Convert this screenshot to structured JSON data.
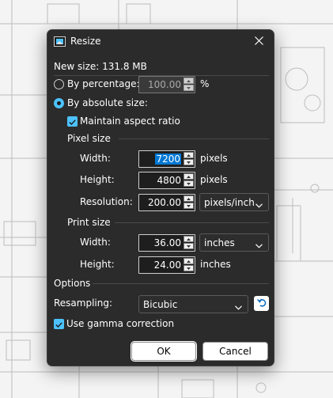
{
  "window": {
    "title": "Resize",
    "close_icon": "close-icon",
    "app_icon": "image-resize-icon"
  },
  "new_size": "New size: 131.8 MB",
  "by_percentage": {
    "label": "By percentage:",
    "value": "100.00",
    "unit": "%",
    "selected": false,
    "enabled": false
  },
  "by_absolute": {
    "label": "By absolute size:",
    "selected": true
  },
  "maintain_aspect": {
    "label": "Maintain aspect ratio",
    "checked": true
  },
  "pixel_size": {
    "heading": "Pixel size",
    "width_label": "Width:",
    "width_value": "7200",
    "width_unit": "pixels",
    "height_label": "Height:",
    "height_value": "4800",
    "height_unit": "pixels",
    "resolution_label": "Resolution:",
    "resolution_value": "200.00",
    "resolution_unit": "pixels/inch"
  },
  "print_size": {
    "heading": "Print size",
    "width_label": "Width:",
    "width_value": "36.00",
    "width_unit": "inches",
    "height_label": "Height:",
    "height_value": "24.00",
    "height_unit": "inches"
  },
  "options": {
    "heading": "Options",
    "resampling_label": "Resampling:",
    "resampling_value": "Bicubic",
    "gamma_label": "Use gamma correction",
    "gamma_checked": true
  },
  "buttons": {
    "ok": "OK",
    "cancel": "Cancel"
  },
  "colors": {
    "accent": "#4cc2ff",
    "dialog_bg": "#2b2b2b",
    "selection": "#0078d4"
  }
}
